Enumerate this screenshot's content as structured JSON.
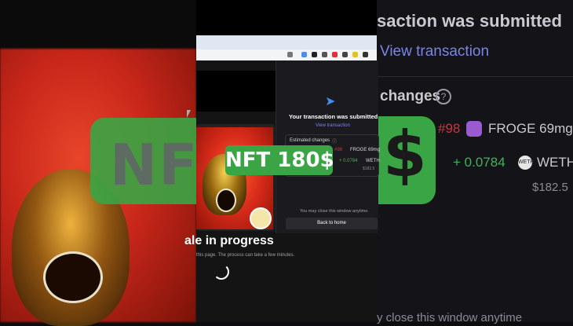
{
  "caption": "NFT 180$",
  "wallet": {
    "title": "Your transaction was submitted",
    "view_link": "View transaction",
    "estimated_changes": "Estimated changes",
    "token_id": "#98",
    "token_name": "FROGE 69mg",
    "amount": "+ 0.0784",
    "amount_token": "WETH",
    "usd_value": "$182.5",
    "close_note": "You may close this window anytime.",
    "back_button": "Back to home"
  },
  "page": {
    "sale_title": "ale in progress",
    "sale_subtitle": "this page. The process can take a few minutes."
  },
  "zoomed_right": {
    "title": "saction was submitted",
    "view_link": "View transaction",
    "changes_label": "changes",
    "token_id": "#98",
    "token_name": "FROGE 69mg",
    "amount": "+ 0.0784",
    "amount_token": "WETH",
    "usd_value": "$182.5",
    "close_note": "y close this window anytime"
  },
  "zoomed_left": {
    "text": "NF"
  },
  "colors": {
    "accent_green": "#3ba545",
    "link_blue": "#7c83e8",
    "negative_red": "#c03a3a",
    "positive_green": "#43b15a"
  },
  "icons": {
    "transaction": "paper-plane-icon",
    "spinner": "loading-spinner-icon",
    "help": "question-circle-icon"
  }
}
